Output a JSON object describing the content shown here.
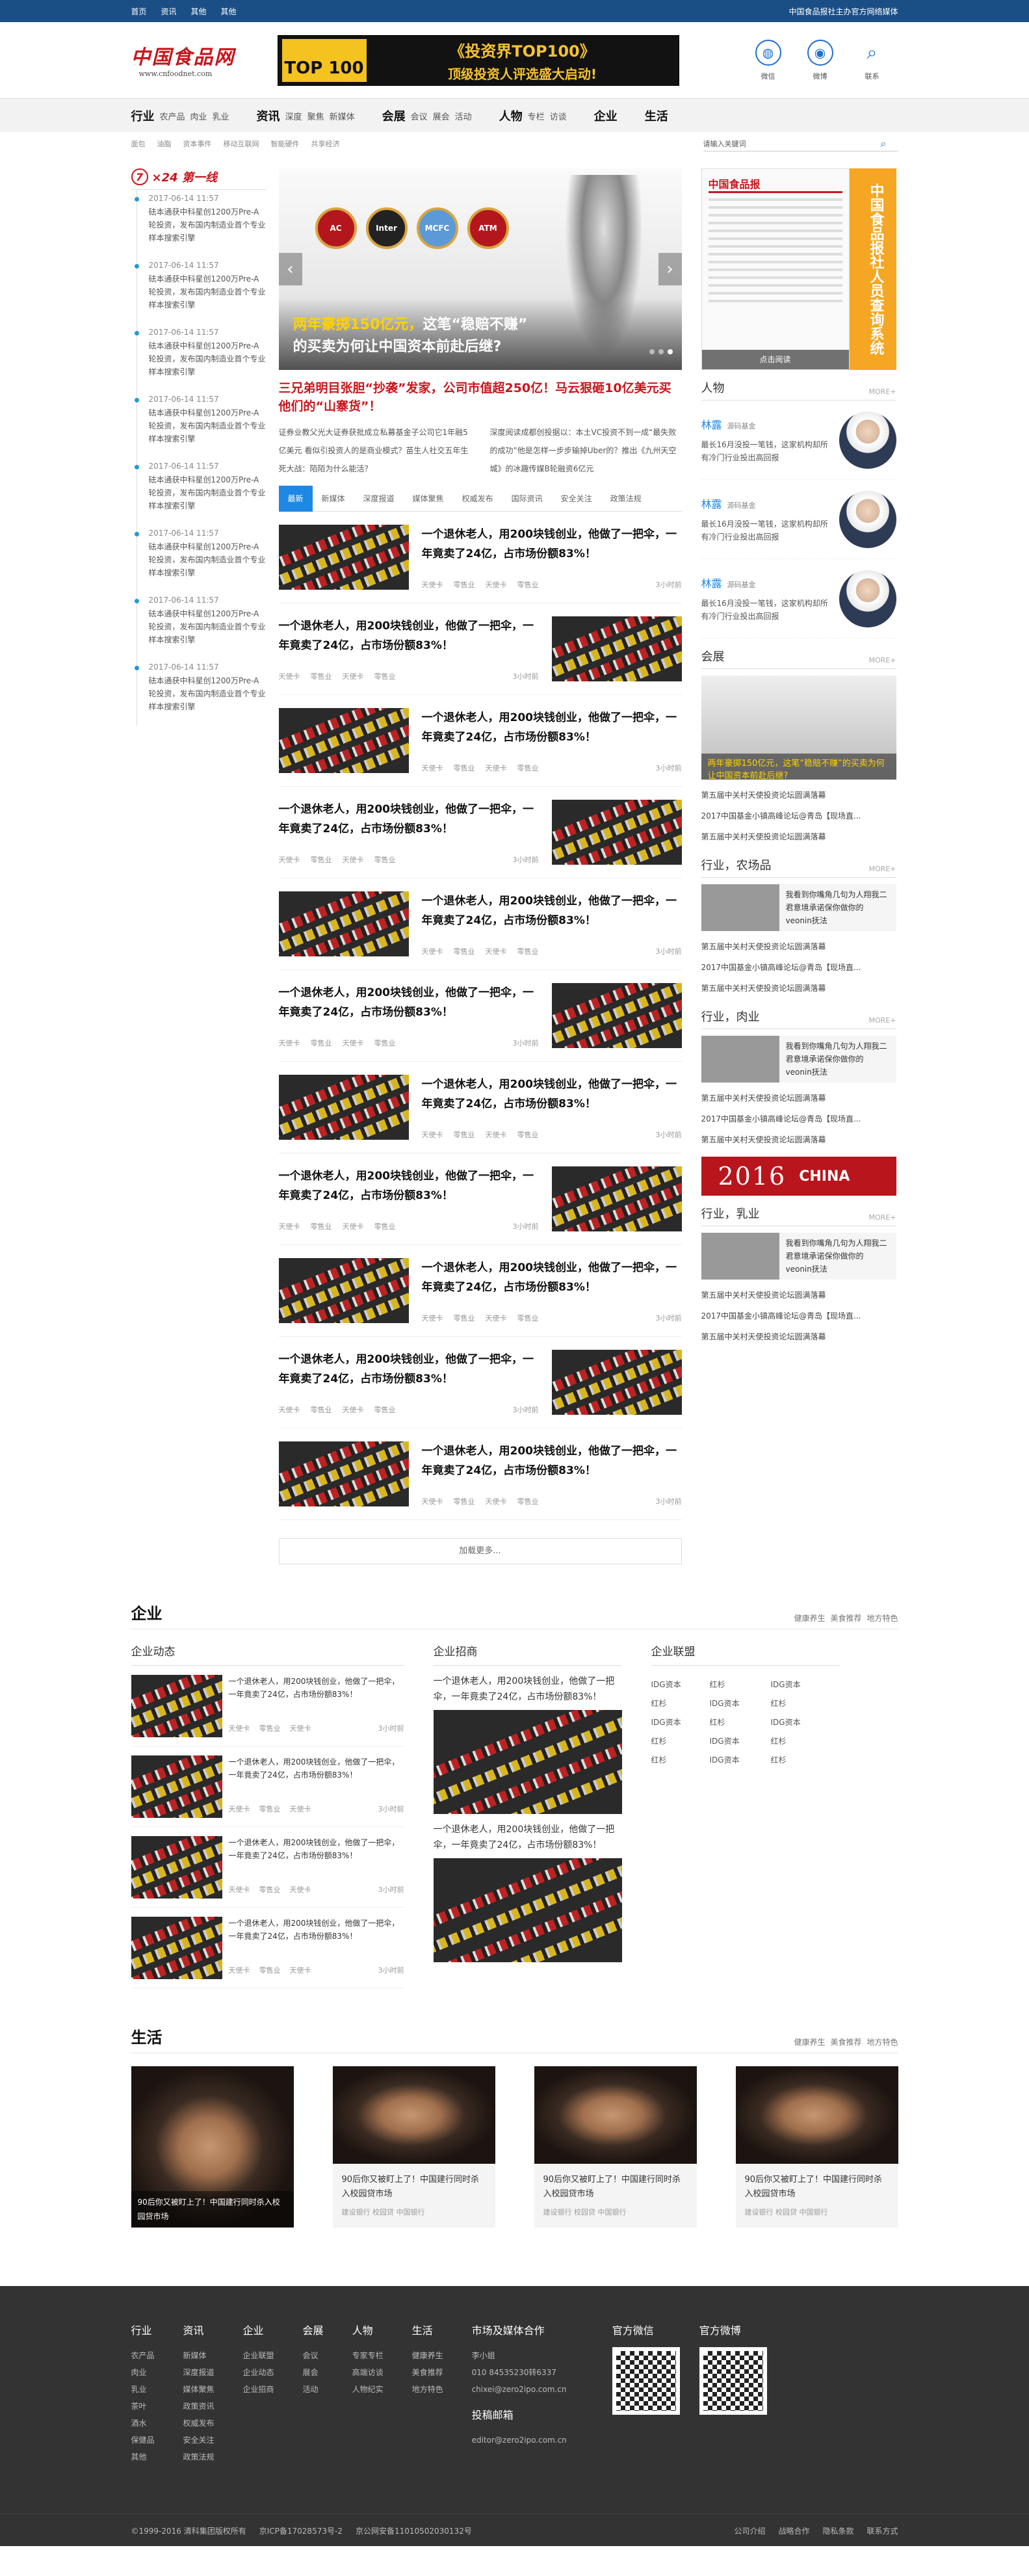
{
  "topbar": {
    "links": [
      "首页",
      "资讯",
      "其他",
      "其他"
    ],
    "slogan": "中国食品报社主办官方网络媒体"
  },
  "header": {
    "logo_cn": "中国食品网",
    "logo_url": "www.cnfoodnet.com",
    "banner_tag": "TOP 100",
    "banner_title": "《投资界TOP100》",
    "banner_sub": "顶级投资人评选盛大启动!",
    "icons": [
      {
        "label": "微信",
        "icon": "wechat-icon"
      },
      {
        "label": "微博",
        "icon": "weibo-icon"
      },
      {
        "label": "联系",
        "icon": "search-icon"
      }
    ]
  },
  "nav": [
    {
      "main": "行业",
      "subs": [
        "农产品",
        "肉业",
        "乳业"
      ]
    },
    {
      "main": "资讯",
      "subs": [
        "深度",
        "聚焦",
        "新媒体"
      ]
    },
    {
      "main": "会展",
      "subs": [
        "会议",
        "展会",
        "活动"
      ]
    },
    {
      "main": "人物",
      "subs": [
        "专栏",
        "访谈"
      ]
    },
    {
      "main": "企业",
      "subs": []
    },
    {
      "main": "生活",
      "subs": []
    }
  ],
  "subnav": [
    "面包",
    "油脂",
    "资本事件",
    "移动互联网",
    "智能硬件",
    "共享经济"
  ],
  "search": {
    "placeholder": "请输入关键词"
  },
  "left": {
    "num": "7",
    "title": "×24 第一线",
    "items": [
      {
        "time": "2017-06-14 11:57",
        "text": "砝本通获中科星创1200万Pre-A轮投资，发布国内制造业首个专业样本搜索引擎"
      },
      {
        "time": "2017-06-14 11:57",
        "text": "砝本通获中科星创1200万Pre-A轮投资，发布国内制造业首个专业样本搜索引擎"
      },
      {
        "time": "2017-06-14 11:57",
        "text": "砝本通获中科星创1200万Pre-A轮投资，发布国内制造业首个专业样本搜索引擎"
      },
      {
        "time": "2017-06-14 11:57",
        "text": "砝本通获中科星创1200万Pre-A轮投资，发布国内制造业首个专业样本搜索引擎"
      },
      {
        "time": "2017-06-14 11:57",
        "text": "砝本通获中科星创1200万Pre-A轮投资，发布国内制造业首个专业样本搜索引擎"
      },
      {
        "time": "2017-06-14 11:57",
        "text": "砝本通获中科星创1200万Pre-A轮投资，发布国内制造业首个专业样本搜索引擎"
      },
      {
        "time": "2017-06-14 11:57",
        "text": "砝本通获中科星创1200万Pre-A轮投资，发布国内制造业首个专业样本搜索引擎"
      },
      {
        "time": "2017-06-14 11:57",
        "text": "砝本通获中科星创1200万Pre-A轮投资，发布国内制造业首个专业样本搜索引擎"
      }
    ]
  },
  "slider": {
    "cap1a": "两年豪掷150亿元，",
    "cap1b": "这笔“稳赔不赚”",
    "cap2": "的买卖为何让中国资本前赴后继?",
    "badges": [
      "AC",
      "Inter",
      "MCFC",
      "ATM"
    ]
  },
  "headline": "三兄弟明目张胆“抄袭”发家，公司市值超250亿！马云狠砸10亿美元买他们的“山寨货”！",
  "intro": [
    "证券业教父光大证券获批成立私募基金子公司它1年融5亿美元 看似引投资人的是商业模式？苗生人社交五年生死大战：陌陌为什么能活？",
    "深度阅读成都创投据以：本土VC投资不到一成“最失败的成功”他是怎样一步步输掉Uber的？推出《九州天空城》的冰趣传媒B轮融资6亿元"
  ],
  "tabs": [
    "最新",
    "新媒体",
    "深度报道",
    "媒体聚焦",
    "权威发布",
    "国际资讯",
    "安全关注",
    "政策法规"
  ],
  "news_tags": [
    "天使卡",
    "零售业",
    "天使卡",
    "零售业"
  ],
  "news": [
    {
      "title": "一个退休老人，用200块钱创业，他做了一把伞，一年竟卖了24亿，占市场份额83%！",
      "time": "3小时前"
    },
    {
      "title": "一个退休老人，用200块钱创业，他做了一把伞，一年竟卖了24亿，占市场份额83%！",
      "time": "3小时前"
    },
    {
      "title": "一个退休老人，用200块钱创业，他做了一把伞，一年竟卖了24亿，占市场份额83%！",
      "time": "3小时前"
    },
    {
      "title": "一个退休老人，用200块钱创业，他做了一把伞，一年竟卖了24亿，占市场份额83%！",
      "time": "3小时前"
    },
    {
      "title": "一个退休老人，用200块钱创业，他做了一把伞，一年竟卖了24亿，占市场份额83%！",
      "time": "3小时前"
    },
    {
      "title": "一个退休老人，用200块钱创业，他做了一把伞，一年竟卖了24亿，占市场份额83%！",
      "time": "3小时前"
    },
    {
      "title": "一个退休老人，用200块钱创业，他做了一把伞，一年竟卖了24亿，占市场份额83%！",
      "time": "3小时前"
    },
    {
      "title": "一个退休老人，用200块钱创业，他做了一把伞，一年竟卖了24亿，占市场份额83%！",
      "time": "3小时前"
    },
    {
      "title": "一个退休老人，用200块钱创业，他做了一把伞，一年竟卖了24亿，占市场份额83%！",
      "time": "3小时前"
    },
    {
      "title": "一个退休老人，用200块钱创业，他做了一把伞，一年竟卖了24亿，占市场份额83%！",
      "time": "3小时前"
    },
    {
      "title": "一个退休老人，用200块钱创业，他做了一把伞，一年竟卖了24亿，占市场份额83%！",
      "time": "3小时前"
    }
  ],
  "load_more": "加载更多...",
  "right": {
    "paper_title": "中国食品报",
    "paper_btn": "点击阅读",
    "paper_side": "中国食品报社人员查询系统",
    "more": "MORE+",
    "people_title": "人物",
    "people": [
      {
        "name": "林露",
        "org": "源码基金",
        "desc": "最长16月没投一笔钱，这家机构却所有冷门行业投出高回报"
      },
      {
        "name": "林露",
        "org": "源码基金",
        "desc": "最长16月没投一笔钱，这家机构却所有冷门行业投出高回报"
      },
      {
        "name": "林露",
        "org": "源码基金",
        "desc": "最长16月没投一笔钱，这家机构却所有冷门行业投出高回报"
      }
    ],
    "expo_title": "会展",
    "expo_cap": "两年豪掷150亿元，这笔“稳赔不赚”的买卖为何让中国资本前赴后继?",
    "expo_list": [
      "第五届中关村天使投资论坛圆满落幕",
      "2017中国基金小镇高峰论坛@青岛【现场直...",
      "第五届中关村天使投资论坛圆满落幕"
    ],
    "sections": [
      {
        "title": "行业，农场品",
        "card": "我看到你嘴角几句为人翔我二君意境承诺保你做你的veonin抚法",
        "list": [
          "第五届中关村天使投资论坛圆满落幕",
          "2017中国基金小镇高峰论坛@青岛【现场直...",
          "第五届中关村天使投资论坛圆满落幕"
        ]
      },
      {
        "title": "行业，肉业",
        "card": "我看到你嘴角几句为人翔我二君意境承诺保你做你的veonin抚法",
        "list": [
          "第五届中关村天使投资论坛圆满落幕",
          "2017中国基金小镇高峰论坛@青岛【现场直...",
          "第五届中关村天使投资论坛圆满落幕"
        ]
      }
    ],
    "ad_year": "2016",
    "ad_text": "CHINA",
    "sections2": [
      {
        "title": "行业，乳业",
        "card": "我看到你嘴角几句为人翔我二君意境承诺保你做你的veonin抚法",
        "list": [
          "第五届中关村天使投资论坛圆满落幕",
          "2017中国基金小镇高峰论坛@青岛【现场直...",
          "第五届中关村天使投资论坛圆满落幕"
        ]
      }
    ]
  },
  "enterprise": {
    "title": "企业",
    "links": [
      "健康养生",
      "美食推荐",
      "地方特色"
    ],
    "col1": "企业动态",
    "col2": "企业招商",
    "col3": "企业联盟",
    "items": [
      {
        "t": "一个退休老人，用200块钱创业，他做了一把伞，一年竟卖了24亿，占市场份额83%！",
        "time": "3小时前"
      },
      {
        "t": "一个退休老人，用200块钱创业，他做了一把伞，一年竟卖了24亿，占市场份额83%！",
        "time": "3小时前"
      },
      {
        "t": "一个退休老人，用200块钱创业，他做了一把伞，一年竟卖了24亿，占市场份额83%！",
        "time": "3小时前"
      },
      {
        "t": "一个退休老人，用200块钱创业，他做了一把伞，一年竟卖了24亿，占市场份额83%！",
        "time": "3小时前"
      }
    ],
    "tags": [
      "天使卡",
      "零售业",
      "天使卡"
    ],
    "zs": [
      "一个退休老人，用200块钱创业，他做了一把伞，一年竟卖了24亿，占市场份额83%！",
      "一个退休老人，用200块钱创业，他做了一把伞，一年竟卖了24亿，占市场份额83%！"
    ],
    "union": [
      "IDG资本",
      "红杉",
      "IDG资本",
      "红杉",
      "IDG资本",
      "红杉",
      "IDG资本",
      "红杉",
      "IDG资本",
      "红杉",
      "IDG资本",
      "红杉",
      "红杉",
      "IDG资本",
      "红杉"
    ]
  },
  "life": {
    "title": "生活",
    "links": [
      "健康养生",
      "美食推荐",
      "地方特色"
    ],
    "big": "90后你又被盯上了！中国建行同时杀入校园贷市场",
    "cards": [
      {
        "t": "90后你又被盯上了！中国建行同时杀入校园贷市场",
        "m": "建设银行 校园贷 中国银行"
      },
      {
        "t": "90后你又被盯上了！中国建行同时杀入校园贷市场",
        "m": "建设银行 校园贷 中国银行"
      },
      {
        "t": "90后你又被盯上了！中国建行同时杀入校园贷市场",
        "m": "建设银行 校园贷 中国银行"
      }
    ]
  },
  "footer": {
    "cols": [
      {
        "h": "行业",
        "i": [
          "农产品",
          "肉业",
          "乳业",
          "茶叶",
          "酒水",
          "保健品",
          "其他"
        ]
      },
      {
        "h": "资讯",
        "i": [
          "新媒体",
          "深度报道",
          "媒体聚焦",
          "政策资讯",
          "权威发布",
          "安全关注",
          "政策法规"
        ]
      },
      {
        "h": "企业",
        "i": [
          "企业联盟",
          "企业动态",
          "企业招商"
        ]
      },
      {
        "h": "会展",
        "i": [
          "会议",
          "展会",
          "活动"
        ]
      },
      {
        "h": "人物",
        "i": [
          "专家专栏",
          "高端访谈",
          "人物纪实"
        ]
      },
      {
        "h": "生活",
        "i": [
          "健康养生",
          "美食推荐",
          "地方特色"
        ]
      }
    ],
    "contact_h": "市场及媒体合作",
    "contact": [
      "李小姐",
      "010 84535230转6337",
      "chixei@zero2ipo.com.cn"
    ],
    "mail_h": "投稿邮箱",
    "mail": "editor@zero2ipo.com.cn",
    "wx": "官方微信",
    "wb": "官方微博",
    "copy": "©1999-2016  清科集团版权所有",
    "icp": "京ICP备17028573号-2",
    "police": "京公网安备11010502030132号",
    "blinks": [
      "公司介绍",
      "战略合作",
      "隐私条款",
      "联系方式"
    ]
  }
}
